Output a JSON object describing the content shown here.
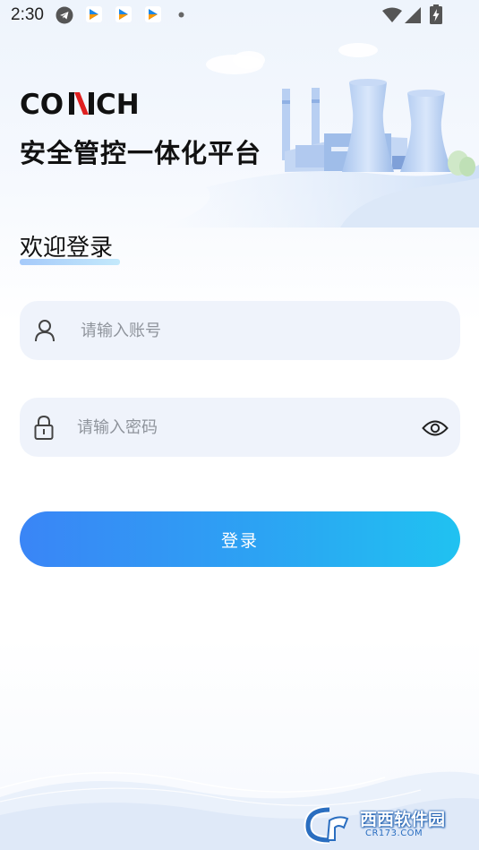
{
  "status_bar": {
    "time": "2:30",
    "icons": [
      "telegram-icon",
      "app-notification-icon",
      "app-notification-icon",
      "app-notification-icon",
      "dot-icon",
      "wifi-icon",
      "signal-icon",
      "battery-charging-icon"
    ]
  },
  "brand": {
    "logo_text_left": "CO",
    "logo_text_right": "CH",
    "logo_accent_color": "#e02020",
    "title": "安全管控一体化平台"
  },
  "login": {
    "welcome": "欢迎登录",
    "account": {
      "placeholder": "请输入账号",
      "value": "",
      "icon": "user-icon"
    },
    "password": {
      "placeholder": "请输入密码",
      "value": "",
      "icon": "lock-icon",
      "toggle_icon": "eye-icon"
    },
    "submit_label": "登录"
  },
  "colors": {
    "button_gradient_start": "#3a85f6",
    "button_gradient_end": "#20c2f1",
    "field_background": "#eff3fb"
  },
  "watermark": {
    "title": "西西软件园",
    "subtitle": "CR173.COM"
  }
}
